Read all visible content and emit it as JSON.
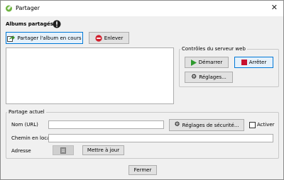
{
  "window": {
    "title": "Partager",
    "close_glyph": "✕"
  },
  "albums": {
    "heading": "Albums partagés",
    "share_button": "Partager l'album en cours",
    "remove_button": "Enlever"
  },
  "server": {
    "legend": "Contrôles du serveur web",
    "start_button": "Démarrer",
    "stop_button": "Arrêter",
    "settings_button": "Réglages..."
  },
  "sharing": {
    "legend": "Partage actuel",
    "name_label": "Nom (URL)",
    "name_value": "",
    "security_button": "Réglages de sécurité...",
    "activate_label": "Activer",
    "activate_checked": false,
    "local_path_label": "Chemin en local",
    "local_path_value": "",
    "address_label": "Adresse",
    "update_button": "Mettre à jour"
  },
  "footer": {
    "close_button": "Fermer"
  },
  "colors": {
    "accent": "#0078d7",
    "start_green": "#2e9a2e",
    "stop_red": "#c8102e",
    "remove_red": "#d21e2b",
    "app_green": "#6db33f"
  }
}
